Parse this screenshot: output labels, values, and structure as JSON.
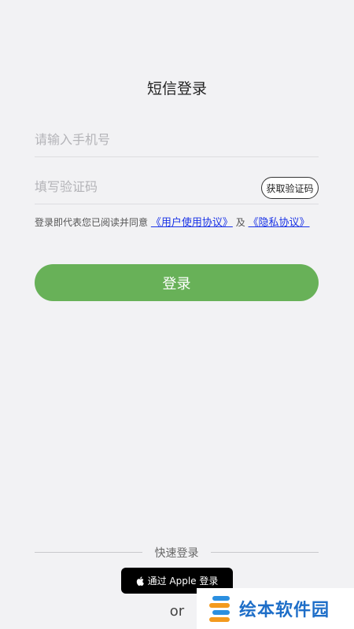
{
  "title": "短信登录",
  "phone": {
    "placeholder": "请输入手机号",
    "value": ""
  },
  "code": {
    "placeholder": "填写验证码",
    "value": "",
    "get_code_label": "获取验证码"
  },
  "agreement": {
    "prefix": "登录即代表您已阅读并同意",
    "user_agreement": "《用户使用协议》",
    "conjunction": "及",
    "privacy_policy": "《隐私协议》"
  },
  "login_label": "登录",
  "quick_login": {
    "label": "快速登录",
    "apple_label": "通过 Apple 登录",
    "or_label": "or"
  },
  "watermark": {
    "text": "绘本软件园"
  },
  "colors": {
    "background": "#f2f2f4",
    "primary_button": "#68b158",
    "link": "#1a33e6",
    "apple_button": "#000000",
    "watermark_text": "#1e6ec8"
  },
  "icons": {
    "apple": "apple-icon",
    "watermark": "watermark-logo-icon"
  }
}
